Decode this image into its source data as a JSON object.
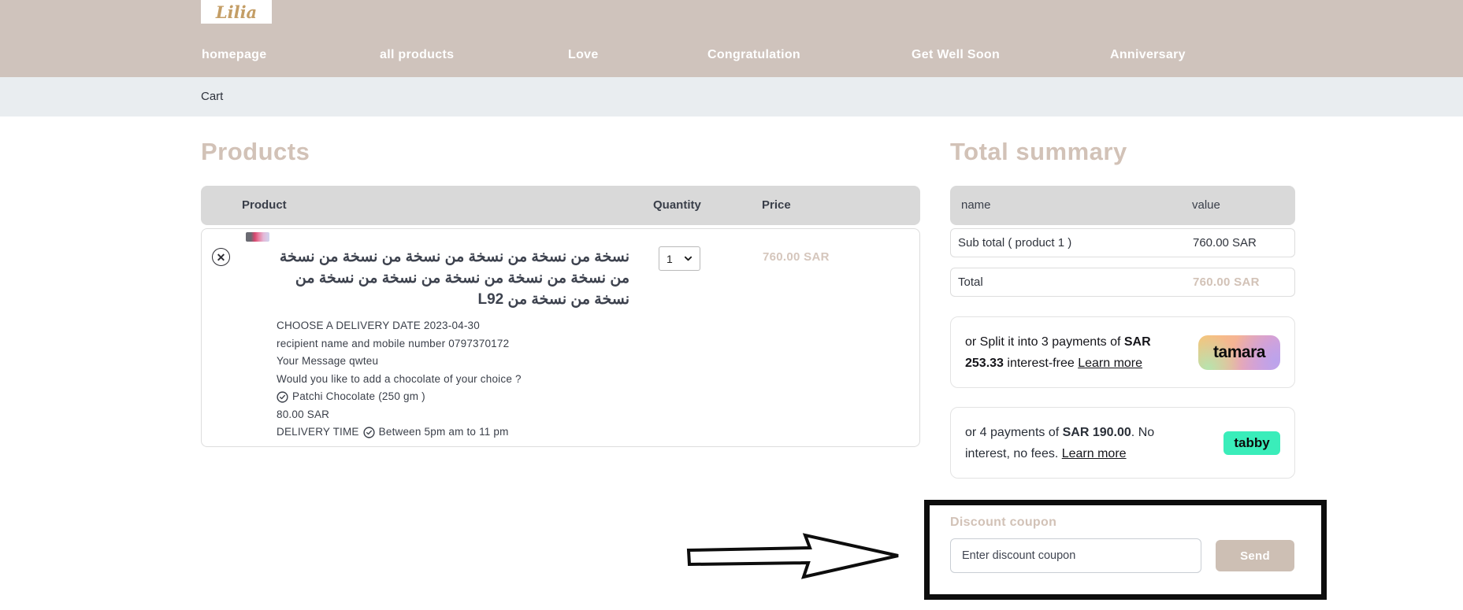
{
  "brand": {
    "logo_text": "Lilia",
    "accent_color": "#d2c2b7",
    "header_bg": "#cfc3bc",
    "tabby_green": "#3aedba"
  },
  "nav": {
    "items": [
      {
        "label": "homepage"
      },
      {
        "label": "all products"
      },
      {
        "label": "Love"
      },
      {
        "label": "Congratulation"
      },
      {
        "label": "Get Well Soon"
      },
      {
        "label": "Anniversary"
      }
    ]
  },
  "breadcrumb": {
    "label": "Cart"
  },
  "products": {
    "title": "Products",
    "columns": {
      "product": "Product",
      "quantity": "Quantity",
      "price": "Price"
    },
    "item": {
      "title_ar": "نسخة من نسخة من نسخة من نسخة من نسخة من نسخة من نسخة من نسخة من نسخة من نسخة من نسخة من نسخة من نسخة من L92",
      "delivery_date": "CHOOSE A DELIVERY DATE 2023-04-30",
      "recipient": "recipient name and mobile number 0797370172",
      "message": "Your Message qwteu",
      "chocolate_question": "Would you like to add a chocolate of your choice ?",
      "chocolate_choice": "Patchi Chocolate (250 gm )",
      "chocolate_price": "80.00 SAR",
      "delivery_time_label": "DELIVERY TIME",
      "delivery_time_value": "Between 5pm am to 11 pm",
      "quantity": "1",
      "price": "760.00 SAR",
      "remove_glyph": "✕"
    }
  },
  "summary": {
    "title": "Total summary",
    "columns": {
      "name": "name",
      "value": "value"
    },
    "rows": [
      {
        "name": "Sub total ( product 1 )",
        "value": "760.00 SAR"
      },
      {
        "name": "Total",
        "value": "760.00 SAR"
      }
    ],
    "tamara": {
      "text_before": "or Split it into 3 payments of ",
      "amount": "SAR 253.33",
      "text_after": " interest-free ",
      "link": "Learn more",
      "logo_text": "tamara"
    },
    "tabby": {
      "text_before": "or 4 payments of ",
      "amount": "SAR 190.00",
      "text_after": ". No interest, no fees. ",
      "link": "Learn more",
      "logo_text": "tabby"
    },
    "coupon": {
      "title": "Discount coupon",
      "placeholder": "Enter discount coupon",
      "button": "Send"
    }
  }
}
